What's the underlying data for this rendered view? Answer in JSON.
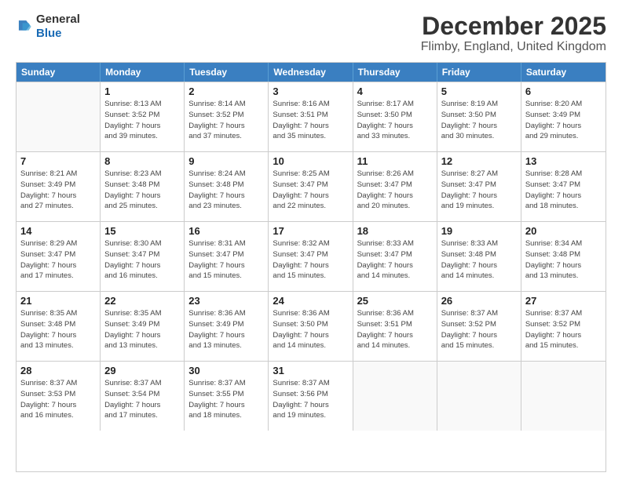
{
  "logo": {
    "general": "General",
    "blue": "Blue"
  },
  "header": {
    "month": "December 2025",
    "location": "Flimby, England, United Kingdom"
  },
  "weekdays": [
    "Sunday",
    "Monday",
    "Tuesday",
    "Wednesday",
    "Thursday",
    "Friday",
    "Saturday"
  ],
  "rows": [
    [
      {
        "day": "",
        "info": ""
      },
      {
        "day": "1",
        "info": "Sunrise: 8:13 AM\nSunset: 3:52 PM\nDaylight: 7 hours\nand 39 minutes."
      },
      {
        "day": "2",
        "info": "Sunrise: 8:14 AM\nSunset: 3:52 PM\nDaylight: 7 hours\nand 37 minutes."
      },
      {
        "day": "3",
        "info": "Sunrise: 8:16 AM\nSunset: 3:51 PM\nDaylight: 7 hours\nand 35 minutes."
      },
      {
        "day": "4",
        "info": "Sunrise: 8:17 AM\nSunset: 3:50 PM\nDaylight: 7 hours\nand 33 minutes."
      },
      {
        "day": "5",
        "info": "Sunrise: 8:19 AM\nSunset: 3:50 PM\nDaylight: 7 hours\nand 30 minutes."
      },
      {
        "day": "6",
        "info": "Sunrise: 8:20 AM\nSunset: 3:49 PM\nDaylight: 7 hours\nand 29 minutes."
      }
    ],
    [
      {
        "day": "7",
        "info": "Sunrise: 8:21 AM\nSunset: 3:49 PM\nDaylight: 7 hours\nand 27 minutes."
      },
      {
        "day": "8",
        "info": "Sunrise: 8:23 AM\nSunset: 3:48 PM\nDaylight: 7 hours\nand 25 minutes."
      },
      {
        "day": "9",
        "info": "Sunrise: 8:24 AM\nSunset: 3:48 PM\nDaylight: 7 hours\nand 23 minutes."
      },
      {
        "day": "10",
        "info": "Sunrise: 8:25 AM\nSunset: 3:47 PM\nDaylight: 7 hours\nand 22 minutes."
      },
      {
        "day": "11",
        "info": "Sunrise: 8:26 AM\nSunset: 3:47 PM\nDaylight: 7 hours\nand 20 minutes."
      },
      {
        "day": "12",
        "info": "Sunrise: 8:27 AM\nSunset: 3:47 PM\nDaylight: 7 hours\nand 19 minutes."
      },
      {
        "day": "13",
        "info": "Sunrise: 8:28 AM\nSunset: 3:47 PM\nDaylight: 7 hours\nand 18 minutes."
      }
    ],
    [
      {
        "day": "14",
        "info": "Sunrise: 8:29 AM\nSunset: 3:47 PM\nDaylight: 7 hours\nand 17 minutes."
      },
      {
        "day": "15",
        "info": "Sunrise: 8:30 AM\nSunset: 3:47 PM\nDaylight: 7 hours\nand 16 minutes."
      },
      {
        "day": "16",
        "info": "Sunrise: 8:31 AM\nSunset: 3:47 PM\nDaylight: 7 hours\nand 15 minutes."
      },
      {
        "day": "17",
        "info": "Sunrise: 8:32 AM\nSunset: 3:47 PM\nDaylight: 7 hours\nand 15 minutes."
      },
      {
        "day": "18",
        "info": "Sunrise: 8:33 AM\nSunset: 3:47 PM\nDaylight: 7 hours\nand 14 minutes."
      },
      {
        "day": "19",
        "info": "Sunrise: 8:33 AM\nSunset: 3:48 PM\nDaylight: 7 hours\nand 14 minutes."
      },
      {
        "day": "20",
        "info": "Sunrise: 8:34 AM\nSunset: 3:48 PM\nDaylight: 7 hours\nand 13 minutes."
      }
    ],
    [
      {
        "day": "21",
        "info": "Sunrise: 8:35 AM\nSunset: 3:48 PM\nDaylight: 7 hours\nand 13 minutes."
      },
      {
        "day": "22",
        "info": "Sunrise: 8:35 AM\nSunset: 3:49 PM\nDaylight: 7 hours\nand 13 minutes."
      },
      {
        "day": "23",
        "info": "Sunrise: 8:36 AM\nSunset: 3:49 PM\nDaylight: 7 hours\nand 13 minutes."
      },
      {
        "day": "24",
        "info": "Sunrise: 8:36 AM\nSunset: 3:50 PM\nDaylight: 7 hours\nand 14 minutes."
      },
      {
        "day": "25",
        "info": "Sunrise: 8:36 AM\nSunset: 3:51 PM\nDaylight: 7 hours\nand 14 minutes."
      },
      {
        "day": "26",
        "info": "Sunrise: 8:37 AM\nSunset: 3:52 PM\nDaylight: 7 hours\nand 15 minutes."
      },
      {
        "day": "27",
        "info": "Sunrise: 8:37 AM\nSunset: 3:52 PM\nDaylight: 7 hours\nand 15 minutes."
      }
    ],
    [
      {
        "day": "28",
        "info": "Sunrise: 8:37 AM\nSunset: 3:53 PM\nDaylight: 7 hours\nand 16 minutes."
      },
      {
        "day": "29",
        "info": "Sunrise: 8:37 AM\nSunset: 3:54 PM\nDaylight: 7 hours\nand 17 minutes."
      },
      {
        "day": "30",
        "info": "Sunrise: 8:37 AM\nSunset: 3:55 PM\nDaylight: 7 hours\nand 18 minutes."
      },
      {
        "day": "31",
        "info": "Sunrise: 8:37 AM\nSunset: 3:56 PM\nDaylight: 7 hours\nand 19 minutes."
      },
      {
        "day": "",
        "info": ""
      },
      {
        "day": "",
        "info": ""
      },
      {
        "day": "",
        "info": ""
      }
    ]
  ]
}
